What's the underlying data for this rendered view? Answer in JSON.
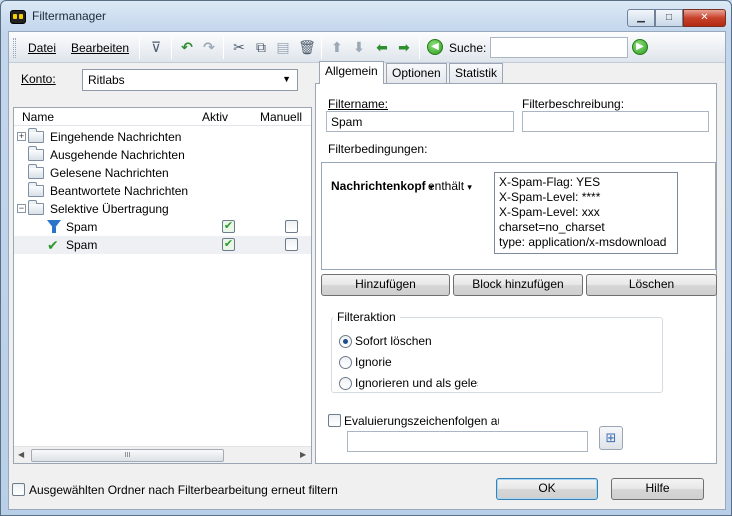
{
  "window": {
    "title": "Filtermanager"
  },
  "menu": {
    "datei": "Datei",
    "bearbeiten": "Bearbeiten"
  },
  "search": {
    "label": "Suche:",
    "value": ""
  },
  "account": {
    "label": "Konto:",
    "selected": "Ritlabs"
  },
  "tree": {
    "columns": {
      "name": "Name",
      "aktiv": "Aktiv",
      "manuell": "Manuell"
    },
    "folders": [
      {
        "label": "Eingehende Nachrichten"
      },
      {
        "label": "Ausgehende Nachrichten"
      },
      {
        "label": "Gelesene Nachrichten"
      },
      {
        "label": "Beantwortete Nachrichten"
      },
      {
        "label": "Selektive Übertragung"
      }
    ],
    "filters": [
      {
        "label": "Spam",
        "aktiv": "✔",
        "manuell": ""
      },
      {
        "label": "Spam",
        "aktiv": "✔",
        "manuell": ""
      }
    ],
    "scroll_grip": "III"
  },
  "tabs": {
    "allgemein": "Allgemein",
    "optionen": "Optionen",
    "statistik": "Statistik"
  },
  "general": {
    "filtername_label": "Filtername:",
    "filtername_value": "Spam",
    "beschreibung_label": "Filterbeschreibung:",
    "beschreibung_value": "",
    "bedingungen_label": "Filterbedingungen:",
    "condition": {
      "field": "Nachrichtenkopf",
      "operator": "enthält",
      "values": [
        "X-Spam-Flag: YES",
        "X-Spam-Level: ****",
        "X-Spam-Level: xxx",
        "charset=no_charset",
        "type: application/x-msdownload"
      ]
    },
    "buttons": {
      "hinzufuegen": "Hinzufügen",
      "block": "Block hinzufügen",
      "loeschen": "Löschen"
    },
    "action": {
      "title": "Filteraktion",
      "options": [
        "Sofort löschen",
        "Ignorie",
        "Ignorieren und als geles"
      ],
      "selected": 0
    },
    "eval_label": "Evaluierungszeichenfolgen au",
    "eval_value": ""
  },
  "footer": {
    "refilter_label": "Ausgewählten Ordner nach Filterbearbeitung erneut filtern",
    "ok": "OK",
    "hilfe": "Hilfe"
  }
}
